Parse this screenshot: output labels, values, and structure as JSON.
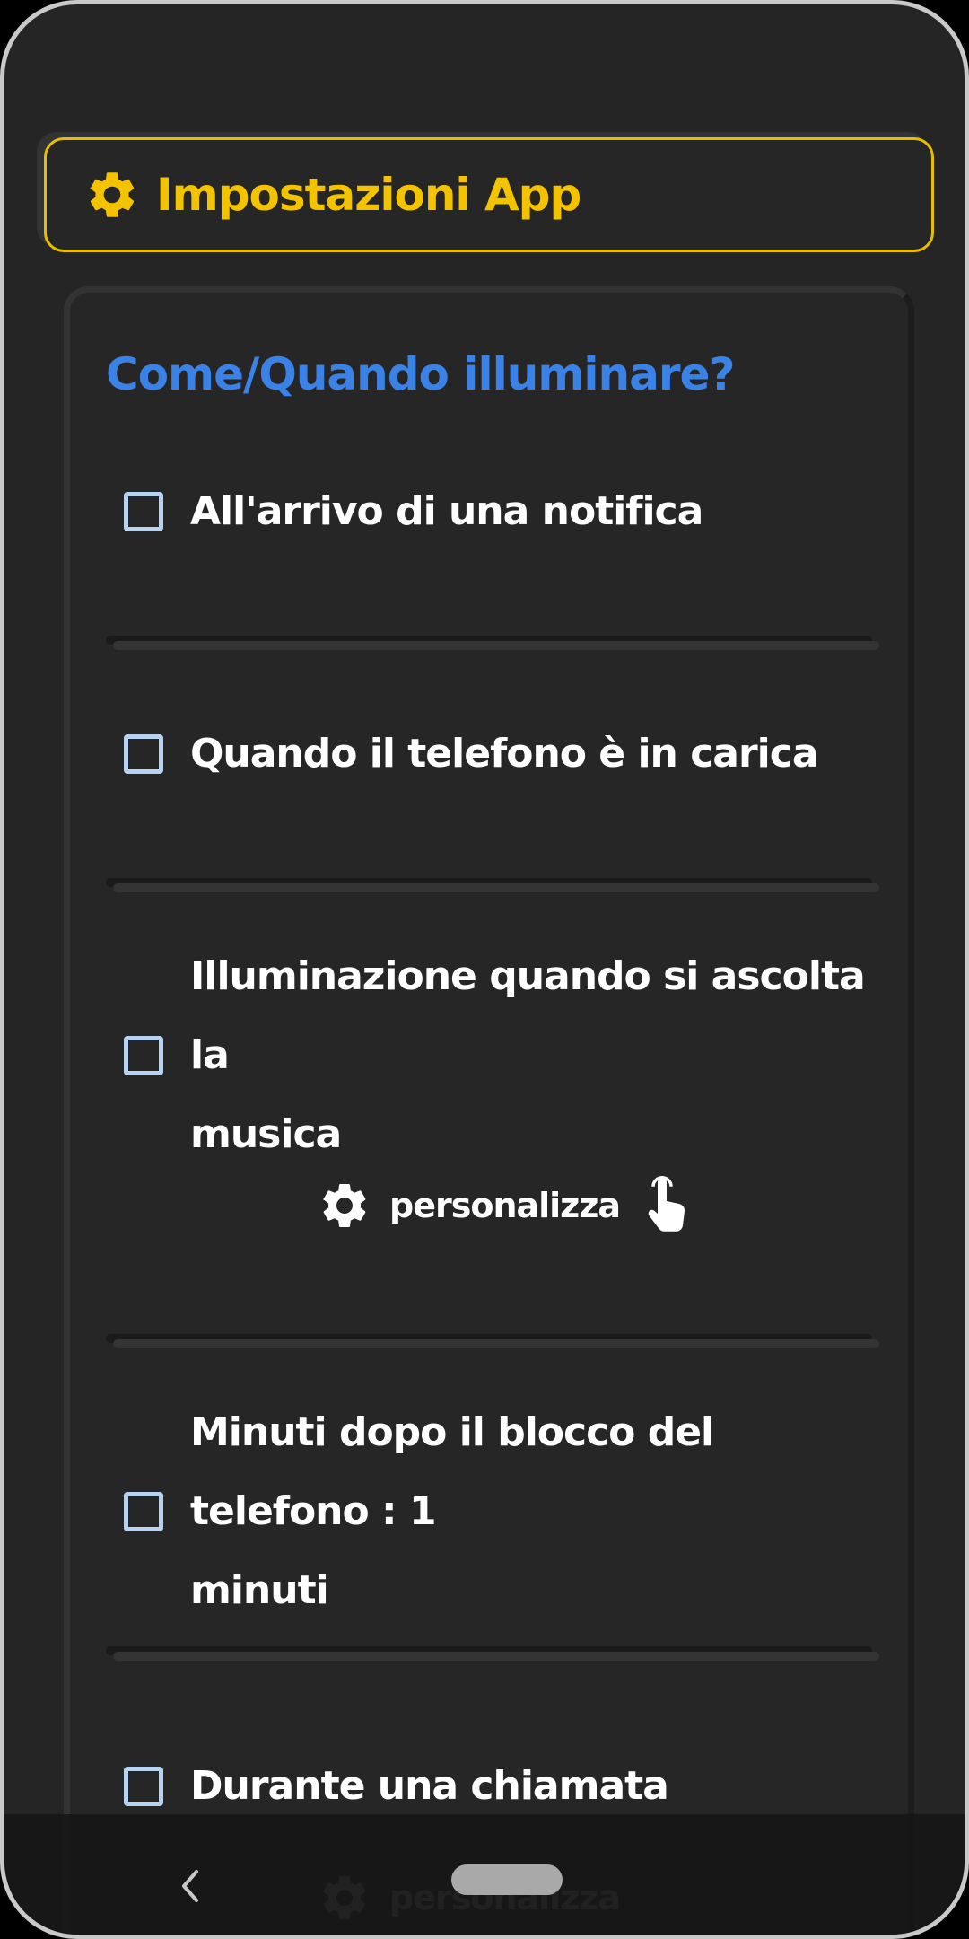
{
  "header": {
    "title": "Impostazioni App",
    "icon": "gear-icon"
  },
  "section": {
    "title": "Come/Quando illuminare?",
    "options": [
      {
        "label": "All'arrivo di una notifica",
        "checked": false
      },
      {
        "label": "Quando il telefono è in carica",
        "checked": false
      },
      {
        "label_line1": "Illuminazione quando si ascolta la",
        "label_line2": "musica",
        "checked": false
      },
      {
        "label_line1": "Minuti dopo il blocco del telefono : 1",
        "label_line2": "minuti",
        "checked": false
      },
      {
        "label": "Durante una chiamata",
        "checked": false
      }
    ],
    "customize_label": "personalizza",
    "customize_label_2": "personalizza"
  },
  "colors": {
    "accent": "#f3c300",
    "section_title": "#3b82e7",
    "checkbox": "#b7d3f2",
    "background": "#252525"
  }
}
